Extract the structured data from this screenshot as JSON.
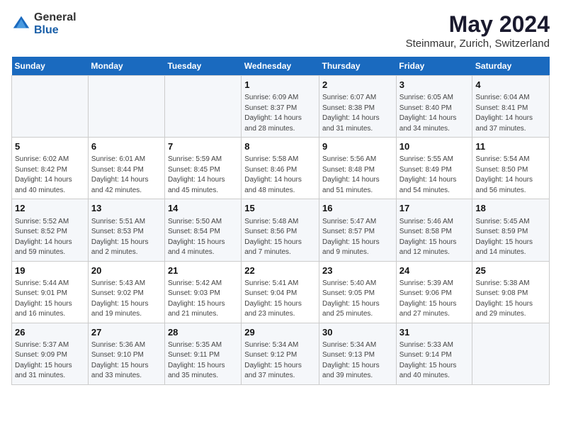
{
  "header": {
    "logo_general": "General",
    "logo_blue": "Blue",
    "main_title": "May 2024",
    "subtitle": "Steinmaur, Zurich, Switzerland"
  },
  "weekdays": [
    "Sunday",
    "Monday",
    "Tuesday",
    "Wednesday",
    "Thursday",
    "Friday",
    "Saturday"
  ],
  "weeks": [
    [
      {
        "day": "",
        "content": ""
      },
      {
        "day": "",
        "content": ""
      },
      {
        "day": "",
        "content": ""
      },
      {
        "day": "1",
        "content": "Sunrise: 6:09 AM\nSunset: 8:37 PM\nDaylight: 14 hours\nand 28 minutes."
      },
      {
        "day": "2",
        "content": "Sunrise: 6:07 AM\nSunset: 8:38 PM\nDaylight: 14 hours\nand 31 minutes."
      },
      {
        "day": "3",
        "content": "Sunrise: 6:05 AM\nSunset: 8:40 PM\nDaylight: 14 hours\nand 34 minutes."
      },
      {
        "day": "4",
        "content": "Sunrise: 6:04 AM\nSunset: 8:41 PM\nDaylight: 14 hours\nand 37 minutes."
      }
    ],
    [
      {
        "day": "5",
        "content": "Sunrise: 6:02 AM\nSunset: 8:42 PM\nDaylight: 14 hours\nand 40 minutes."
      },
      {
        "day": "6",
        "content": "Sunrise: 6:01 AM\nSunset: 8:44 PM\nDaylight: 14 hours\nand 42 minutes."
      },
      {
        "day": "7",
        "content": "Sunrise: 5:59 AM\nSunset: 8:45 PM\nDaylight: 14 hours\nand 45 minutes."
      },
      {
        "day": "8",
        "content": "Sunrise: 5:58 AM\nSunset: 8:46 PM\nDaylight: 14 hours\nand 48 minutes."
      },
      {
        "day": "9",
        "content": "Sunrise: 5:56 AM\nSunset: 8:48 PM\nDaylight: 14 hours\nand 51 minutes."
      },
      {
        "day": "10",
        "content": "Sunrise: 5:55 AM\nSunset: 8:49 PM\nDaylight: 14 hours\nand 54 minutes."
      },
      {
        "day": "11",
        "content": "Sunrise: 5:54 AM\nSunset: 8:50 PM\nDaylight: 14 hours\nand 56 minutes."
      }
    ],
    [
      {
        "day": "12",
        "content": "Sunrise: 5:52 AM\nSunset: 8:52 PM\nDaylight: 14 hours\nand 59 minutes."
      },
      {
        "day": "13",
        "content": "Sunrise: 5:51 AM\nSunset: 8:53 PM\nDaylight: 15 hours\nand 2 minutes."
      },
      {
        "day": "14",
        "content": "Sunrise: 5:50 AM\nSunset: 8:54 PM\nDaylight: 15 hours\nand 4 minutes."
      },
      {
        "day": "15",
        "content": "Sunrise: 5:48 AM\nSunset: 8:56 PM\nDaylight: 15 hours\nand 7 minutes."
      },
      {
        "day": "16",
        "content": "Sunrise: 5:47 AM\nSunset: 8:57 PM\nDaylight: 15 hours\nand 9 minutes."
      },
      {
        "day": "17",
        "content": "Sunrise: 5:46 AM\nSunset: 8:58 PM\nDaylight: 15 hours\nand 12 minutes."
      },
      {
        "day": "18",
        "content": "Sunrise: 5:45 AM\nSunset: 8:59 PM\nDaylight: 15 hours\nand 14 minutes."
      }
    ],
    [
      {
        "day": "19",
        "content": "Sunrise: 5:44 AM\nSunset: 9:01 PM\nDaylight: 15 hours\nand 16 minutes."
      },
      {
        "day": "20",
        "content": "Sunrise: 5:43 AM\nSunset: 9:02 PM\nDaylight: 15 hours\nand 19 minutes."
      },
      {
        "day": "21",
        "content": "Sunrise: 5:42 AM\nSunset: 9:03 PM\nDaylight: 15 hours\nand 21 minutes."
      },
      {
        "day": "22",
        "content": "Sunrise: 5:41 AM\nSunset: 9:04 PM\nDaylight: 15 hours\nand 23 minutes."
      },
      {
        "day": "23",
        "content": "Sunrise: 5:40 AM\nSunset: 9:05 PM\nDaylight: 15 hours\nand 25 minutes."
      },
      {
        "day": "24",
        "content": "Sunrise: 5:39 AM\nSunset: 9:06 PM\nDaylight: 15 hours\nand 27 minutes."
      },
      {
        "day": "25",
        "content": "Sunrise: 5:38 AM\nSunset: 9:08 PM\nDaylight: 15 hours\nand 29 minutes."
      }
    ],
    [
      {
        "day": "26",
        "content": "Sunrise: 5:37 AM\nSunset: 9:09 PM\nDaylight: 15 hours\nand 31 minutes."
      },
      {
        "day": "27",
        "content": "Sunrise: 5:36 AM\nSunset: 9:10 PM\nDaylight: 15 hours\nand 33 minutes."
      },
      {
        "day": "28",
        "content": "Sunrise: 5:35 AM\nSunset: 9:11 PM\nDaylight: 15 hours\nand 35 minutes."
      },
      {
        "day": "29",
        "content": "Sunrise: 5:34 AM\nSunset: 9:12 PM\nDaylight: 15 hours\nand 37 minutes."
      },
      {
        "day": "30",
        "content": "Sunrise: 5:34 AM\nSunset: 9:13 PM\nDaylight: 15 hours\nand 39 minutes."
      },
      {
        "day": "31",
        "content": "Sunrise: 5:33 AM\nSunset: 9:14 PM\nDaylight: 15 hours\nand 40 minutes."
      },
      {
        "day": "",
        "content": ""
      }
    ]
  ]
}
